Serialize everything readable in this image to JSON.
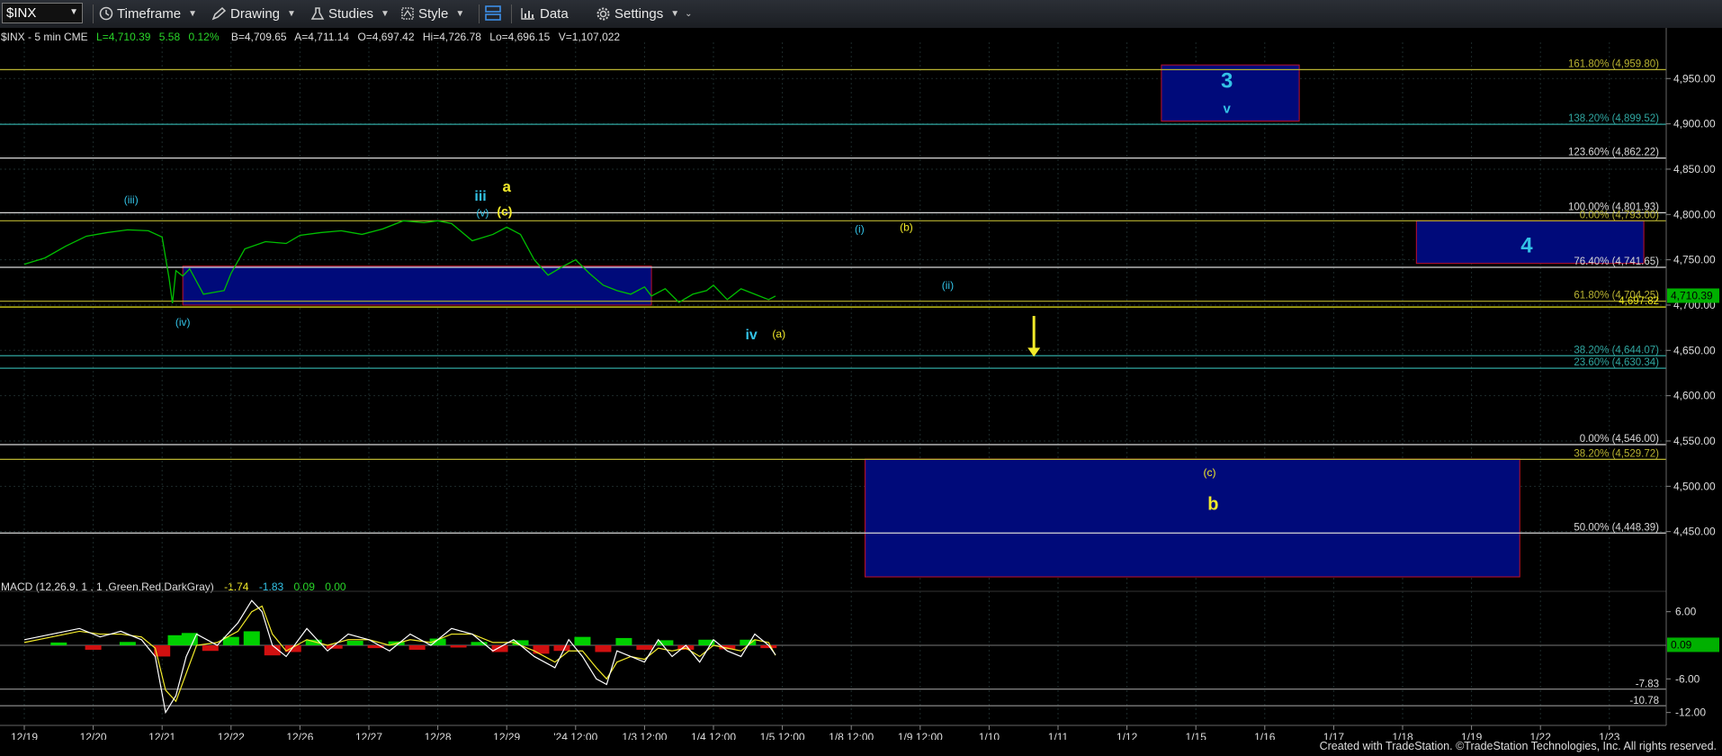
{
  "toolbar": {
    "symbol": "$INX",
    "timeframe": "Timeframe",
    "drawing": "Drawing",
    "studies": "Studies",
    "style": "Style",
    "data": "Data",
    "settings": "Settings"
  },
  "footer": {
    "credit": "Created with TradeStation. ©TradeStation Technologies, Inc. All rights reserved."
  },
  "colors": {
    "price": "#00c000",
    "zone": "#000a7a",
    "zone_border": "#c0102a",
    "cyan": "#33c2e6",
    "yellow": "#f2ea2a",
    "grid": "#2a3a3a"
  },
  "chart_data": [
    {
      "type": "line",
      "header": {
        "name": "$INX - 5 min  CME",
        "last": "L=4,710.39",
        "change": "5.58",
        "pct": "0.12%",
        "bid": "B=4,709.65",
        "ask": "A=4,711.14",
        "open": "O=4,697.42",
        "high": "Hi=4,726.78",
        "low": "Lo=4,696.15",
        "volume": "V=1,107,022"
      },
      "x_ticks": [
        "12/19",
        "12/20",
        "12/21",
        "12/22",
        "12/26",
        "12/27",
        "12/28",
        "12/29",
        "'24 12:00",
        "1/3 12:00",
        "1/4 12:00",
        "1/5 12:00",
        "1/8 12:00",
        "1/9 12:00",
        "1/10",
        "1/11",
        "1/12",
        "1/15",
        "1/16",
        "1/17",
        "1/18",
        "1/19",
        "1/22",
        "1/23"
      ],
      "y_ticks": [
        "4,950.00",
        "4,900.00",
        "4,850.00",
        "4,800.00",
        "4,750.00",
        "4,700.00",
        "4,650.00",
        "4,600.00",
        "4,550.00",
        "4,500.00",
        "4,450.00"
      ],
      "ylim": [
        4400,
        4990
      ],
      "last_price_label": "4,710.39",
      "price_series": {
        "name": "$INX",
        "x": [
          0,
          0.3,
          0.6,
          0.9,
          1.2,
          1.5,
          1.8,
          2.0,
          2.1,
          2.15,
          2.2,
          2.3,
          2.4,
          2.6,
          2.9,
          3.0,
          3.2,
          3.5,
          3.8,
          4.0,
          4.3,
          4.6,
          4.9,
          5.2,
          5.5,
          5.8,
          6.0,
          6.2,
          6.5,
          6.8,
          7.0,
          7.2,
          7.4,
          7.6,
          7.8,
          8.0,
          8.2,
          8.4,
          8.6,
          8.8,
          9.0,
          9.1,
          9.3,
          9.5,
          9.7,
          9.9,
          10.0,
          10.2,
          10.4,
          10.6,
          10.8,
          10.9
        ],
        "y": [
          4745,
          4752,
          4765,
          4776,
          4780,
          4783,
          4782,
          4775,
          4730,
          4702,
          4738,
          4732,
          4740,
          4712,
          4716,
          4735,
          4762,
          4770,
          4768,
          4777,
          4780,
          4782,
          4778,
          4784,
          4793,
          4791,
          4793,
          4790,
          4771,
          4778,
          4786,
          4778,
          4750,
          4733,
          4742,
          4750,
          4735,
          4722,
          4716,
          4712,
          4720,
          4710,
          4718,
          4703,
          4712,
          4716,
          4722,
          4706,
          4718,
          4712,
          4706,
          4710
        ]
      },
      "fib_levels": [
        {
          "label": "161.80% (4,959.80)",
          "value": 4959.8,
          "color": "#b9b331"
        },
        {
          "label": "138.20% (4,899.52)",
          "value": 4899.52,
          "color": "#2fa6a0"
        },
        {
          "label": "123.60% (4,862.22)",
          "value": 4862.22,
          "color": "#d8d8d8"
        },
        {
          "label": "100.00% (4,801.93)",
          "value": 4801.93,
          "color": "#d8d8d8"
        },
        {
          "label": "0.00% (4,793.00)",
          "value": 4793.0,
          "color": "#b9b331"
        },
        {
          "label": "76.40% (4,741.65)",
          "value": 4741.65,
          "color": "#d8d8d8"
        },
        {
          "label": "61.80% (4,704.25)",
          "value": 4704.25,
          "color": "#b9b331"
        },
        {
          "label": "4,697.82",
          "value": 4697.82,
          "color": "#e6e21a"
        },
        {
          "label": "38.20% (4,644.07)",
          "value": 4644.07,
          "color": "#2fa6a0"
        },
        {
          "label": "23.60% (4,630.34)",
          "value": 4630.34,
          "color": "#2fa6a0"
        },
        {
          "label": "0.00% (4,546.00)",
          "value": 4546.0,
          "color": "#d8d8d8"
        },
        {
          "label": "38.20% (4,529.72)",
          "value": 4529.72,
          "color": "#b9b331"
        },
        {
          "label": "50.00% (4,448.39)",
          "value": 4448.39,
          "color": "#d8d8d8"
        }
      ],
      "zones": [
        {
          "name": "zone-3",
          "x0": 16.5,
          "x1": 18.5,
          "y0": 4903,
          "y1": 4965
        },
        {
          "name": "zone-4",
          "x0": 20.2,
          "x1": 23.5,
          "y0": 4746,
          "y1": 4793
        },
        {
          "name": "zone-b",
          "x0": 12.2,
          "x1": 21.7,
          "y0": 4400,
          "y1": 4530
        },
        {
          "name": "zone-support",
          "x0": 2.3,
          "x1": 9.1,
          "y0": 4700,
          "y1": 4743
        }
      ],
      "annotations": [
        {
          "text": "3",
          "x": 17.45,
          "y": 4940,
          "color": "#33c2e6",
          "size": 24,
          "bold": true
        },
        {
          "text": "v",
          "x": 17.45,
          "y": 4912,
          "color": "#33c2e6",
          "size": 15,
          "bold": true
        },
        {
          "text": "4",
          "x": 21.8,
          "y": 4758,
          "color": "#33c2e6",
          "size": 24,
          "bold": true
        },
        {
          "text": "(iii)",
          "x": 1.55,
          "y": 4812,
          "color": "#33c2e6",
          "size": 12,
          "bold": false
        },
        {
          "text": "iii",
          "x": 6.62,
          "y": 4815,
          "color": "#33c2e6",
          "size": 16,
          "bold": true
        },
        {
          "text": "(v)",
          "x": 6.65,
          "y": 4798,
          "color": "#33c2e6",
          "size": 12,
          "bold": false
        },
        {
          "text": "a",
          "x": 7.0,
          "y": 4825,
          "color": "#f2ea2a",
          "size": 17,
          "bold": true
        },
        {
          "text": "(c)",
          "x": 6.97,
          "y": 4799,
          "color": "#f2ea2a",
          "size": 14,
          "bold": true
        },
        {
          "text": "(iv)",
          "x": 2.3,
          "y": 4677,
          "color": "#33c2e6",
          "size": 12,
          "bold": false
        },
        {
          "text": "(i)",
          "x": 12.12,
          "y": 4780,
          "color": "#33c2e6",
          "size": 12,
          "bold": false
        },
        {
          "text": "(b)",
          "x": 12.8,
          "y": 4782,
          "color": "#f2ea2a",
          "size": 12,
          "bold": false
        },
        {
          "text": "(ii)",
          "x": 13.4,
          "y": 4718,
          "color": "#33c2e6",
          "size": 12,
          "bold": false
        },
        {
          "text": "iv",
          "x": 10.55,
          "y": 4662,
          "color": "#33c2e6",
          "size": 16,
          "bold": true
        },
        {
          "text": "(a)",
          "x": 10.95,
          "y": 4664,
          "color": "#f2ea2a",
          "size": 12,
          "bold": false
        },
        {
          "text": "(c)",
          "x": 17.2,
          "y": 4511,
          "color": "#f2ea2a",
          "size": 12,
          "bold": false
        },
        {
          "text": "b",
          "x": 17.25,
          "y": 4474,
          "color": "#f2ea2a",
          "size": 20,
          "bold": true
        }
      ],
      "arrow": {
        "x": 14.65,
        "y_from": 4688,
        "y_to": 4645,
        "color": "#f2ea2a"
      }
    },
    {
      "type": "line",
      "header": {
        "name": "MACD (12,26,9, 1 , 1 ,Green,Red,DarkGray)",
        "macd": "-1.74",
        "signal": "-1.83",
        "diff": "0.09",
        "zero": "0.00"
      },
      "y_ticks": [
        "6.00",
        "-6.00",
        "-12.00"
      ],
      "ylim": [
        -13.5,
        9
      ],
      "level_labels": [
        "-7.83",
        "-10.78"
      ],
      "level_values": [
        -7.83,
        -10.78
      ],
      "last_label": "0.09",
      "macd_series": {
        "name": "MACD",
        "x": [
          0,
          0.4,
          0.8,
          1.1,
          1.4,
          1.7,
          1.9,
          2.05,
          2.2,
          2.35,
          2.5,
          2.8,
          3.1,
          3.3,
          3.45,
          3.6,
          3.8,
          4.1,
          4.4,
          4.7,
          5.0,
          5.3,
          5.6,
          5.9,
          6.2,
          6.5,
          6.8,
          7.1,
          7.4,
          7.7,
          7.9,
          8.1,
          8.3,
          8.45,
          8.6,
          8.8,
          9.0,
          9.2,
          9.4,
          9.6,
          9.8,
          10.0,
          10.2,
          10.4,
          10.6,
          10.8,
          10.9
        ],
        "y": [
          1,
          2,
          3,
          1.5,
          2.5,
          1,
          -2,
          -12,
          -9,
          -2,
          2,
          0,
          4,
          8,
          6,
          0,
          -2,
          3,
          -1,
          2,
          1,
          -1,
          2,
          0,
          3,
          2,
          -1,
          1,
          -2,
          -4,
          1,
          -2,
          -6,
          -7,
          -1,
          -2,
          -3,
          1,
          -2,
          0,
          -3,
          1,
          -1,
          -2,
          2,
          0,
          -1.7
        ]
      },
      "signal_series": {
        "name": "Signal",
        "x": [
          0,
          0.4,
          0.8,
          1.1,
          1.4,
          1.7,
          1.9,
          2.05,
          2.2,
          2.35,
          2.5,
          2.8,
          3.1,
          3.3,
          3.45,
          3.6,
          3.8,
          4.1,
          4.4,
          4.7,
          5.0,
          5.3,
          5.6,
          5.9,
          6.2,
          6.5,
          6.8,
          7.1,
          7.4,
          7.7,
          7.9,
          8.1,
          8.3,
          8.45,
          8.6,
          8.8,
          9.0,
          9.2,
          9.4,
          9.6,
          9.8,
          10.0,
          10.2,
          10.4,
          10.6,
          10.8,
          10.9
        ],
        "y": [
          0.5,
          1.5,
          2.5,
          2,
          2,
          1.5,
          -0.5,
          -8,
          -10,
          -5,
          0,
          0.5,
          2.5,
          6,
          7,
          2,
          -1,
          1,
          0,
          1,
          1,
          0,
          1,
          0.5,
          2,
          2,
          0.5,
          0.5,
          -1,
          -3,
          -1,
          -1,
          -4,
          -6,
          -3,
          -2,
          -2.5,
          -0.5,
          -1,
          -0.5,
          -2,
          0,
          -0.5,
          -1,
          1,
          0.5,
          -1.8
        ]
      },
      "hist_series": {
        "name": "Histogram",
        "x": [
          0.5,
          1.0,
          1.5,
          2.0,
          2.2,
          2.4,
          2.7,
          3.0,
          3.3,
          3.6,
          3.9,
          4.2,
          4.5,
          4.8,
          5.1,
          5.4,
          5.7,
          6.0,
          6.3,
          6.6,
          6.9,
          7.2,
          7.5,
          7.8,
          8.1,
          8.4,
          8.7,
          9.0,
          9.3,
          9.6,
          9.9,
          10.2,
          10.5,
          10.8
        ],
        "y": [
          0.5,
          -0.8,
          0.6,
          -2,
          1.8,
          2.2,
          -1,
          1.5,
          2.5,
          -1.8,
          -1.2,
          1,
          -0.6,
          0.8,
          -0.5,
          0.7,
          -0.8,
          1.2,
          -0.4,
          0.6,
          -1.2,
          0.9,
          -1.5,
          -1,
          1.5,
          -1.2,
          1.3,
          -0.8,
          0.9,
          -0.8,
          1,
          -0.7,
          1,
          -0.5
        ]
      }
    }
  ]
}
